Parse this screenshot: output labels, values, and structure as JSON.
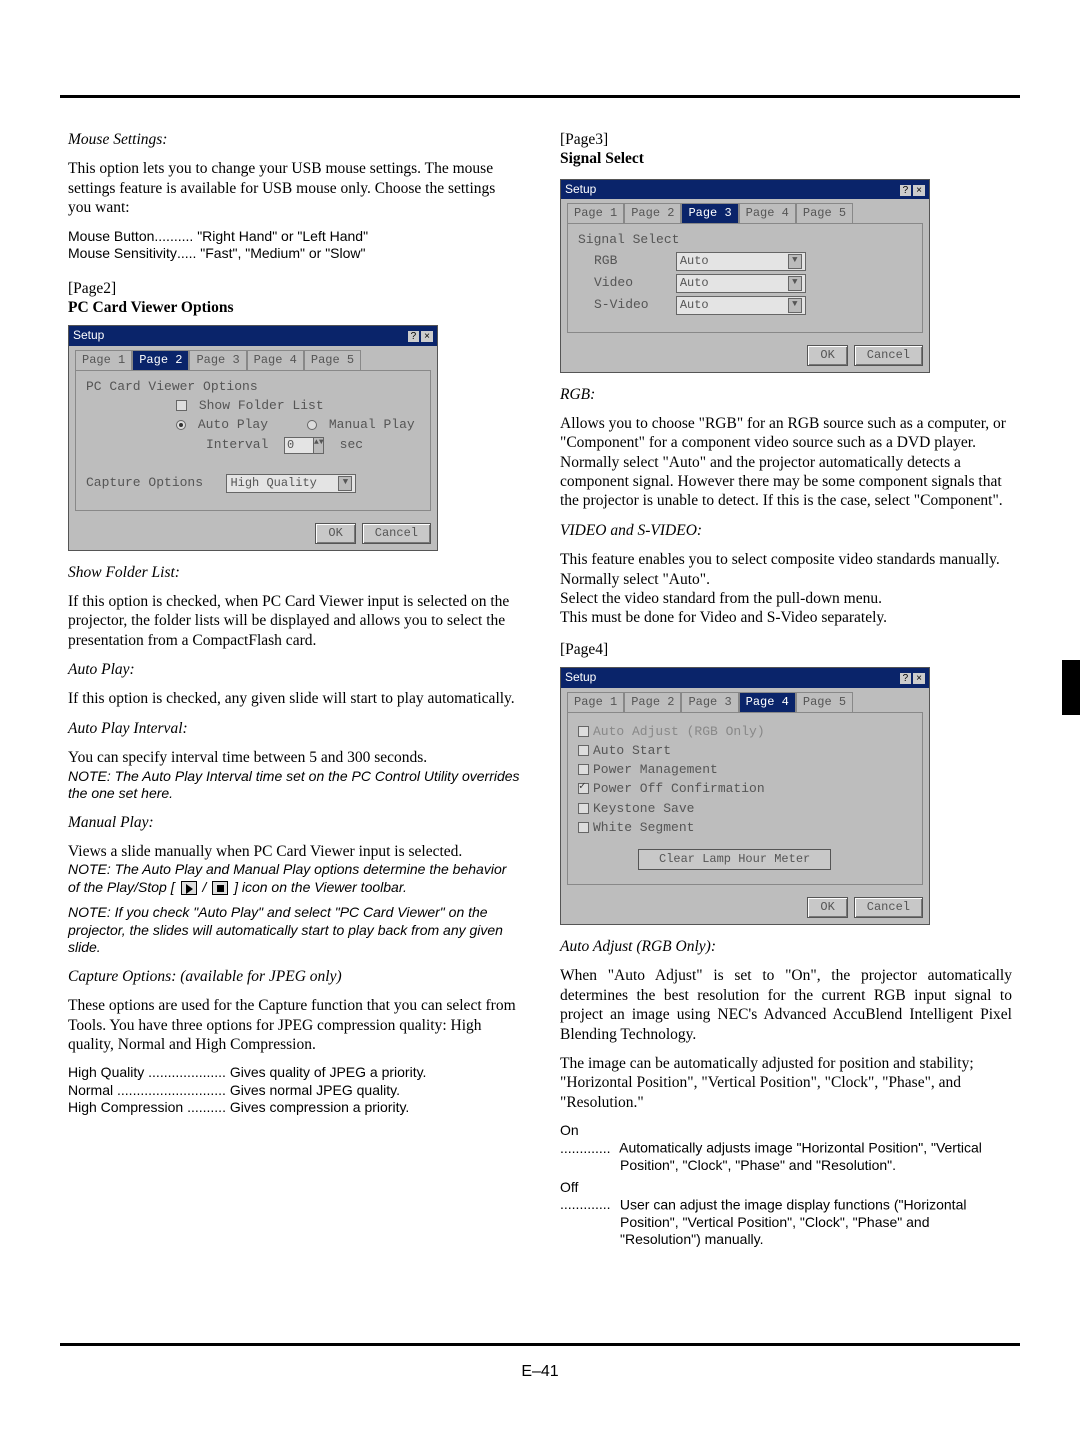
{
  "col1": {
    "mouseSettings": {
      "title": "Mouse Settings:",
      "p1": "This option lets you to change your USB mouse settings. The mouse settings feature is available for USB mouse only. Choose the settings you want:",
      "btn_label": "Mouse Button",
      "btn_dots": "..........",
      "btn_val": "\"Right Hand\" or \"Left Hand\"",
      "sens_label": "Mouse Sensitivity",
      "sens_dots": ".....",
      "sens_val": "\"Fast\", \"Medium\" or \"Slow\""
    },
    "page2_label": "[Page2]",
    "page2_title": "PC Card Viewer Options",
    "dlg2": {
      "title": "Setup",
      "tabs": [
        "Page 1",
        "Page 2",
        "Page 3",
        "Page 4",
        "Page 5"
      ],
      "active_tab": 1,
      "section": "PC Card Viewer Options",
      "chk_show": "Show Folder List",
      "r_auto": "Auto Play",
      "r_manual": "Manual Play",
      "interval_lbl": "Interval",
      "interval_val": "0",
      "interval_unit": "sec",
      "capture_lbl": "Capture Options",
      "capture_val": "High Quality",
      "ok": "OK",
      "cancel": "Cancel"
    },
    "showFolder": {
      "title": "Show Folder List:",
      "p": "If this option is checked, when PC Card Viewer input is selected on the projector, the folder lists will be displayed and allows you to select the presentation from a CompactFlash card."
    },
    "autoPlay": {
      "title": "Auto Play:",
      "p": "If this option is checked, any given slide will start to play automatically."
    },
    "autoPlayInt": {
      "title": "Auto Play Interval:",
      "p": "You can specify interval time between 5 and 300 seconds.",
      "note": "NOTE: The Auto Play Interval time set on the PC Control Utility overrides the one set here."
    },
    "manualPlay": {
      "title": "Manual Play:",
      "p": "Views a slide manually when PC Card Viewer input is selected.",
      "note1a": "NOTE: The Auto Play and Manual Play options determine the behavior of the Play/Stop [",
      "note1b": " / ",
      "note1c": " ] icon on the Viewer toolbar.",
      "note2": "NOTE: If you check \"Auto Play\" and select \"PC Card Viewer\" on the projector, the slides will automatically start to play back from any given slide."
    },
    "capture": {
      "title": "Capture Options: (available for JPEG only)",
      "p": "These options are used for the Capture function that you can select from Tools. You have three options for JPEG compression quality: High quality, Normal and High Compression.",
      "hq_l": "High Quality",
      "hq_d": "....................",
      "hq_v": "Gives quality of JPEG a priority.",
      "nm_l": "Normal",
      "nm_d": "............................",
      "nm_v": "Gives normal JPEG quality.",
      "hc_l": "High Compression",
      "hc_d": "..........",
      "hc_v": "Gives compression a priority."
    }
  },
  "col2": {
    "page3_label": "[Page3]",
    "page3_title": "Signal Select",
    "dlg3": {
      "title": "Setup",
      "tabs": [
        "Page 1",
        "Page 2",
        "Page 3",
        "Page 4",
        "Page 5"
      ],
      "active_tab": 2,
      "section": "Signal Select",
      "rgb_l": "RGB",
      "rgb_v": "Auto",
      "vid_l": "Video",
      "vid_v": "Auto",
      "svid_l": "S-Video",
      "svid_v": "Auto",
      "ok": "OK",
      "cancel": "Cancel"
    },
    "rgb": {
      "title": "RGB:",
      "p": "Allows you to choose \"RGB\" for an RGB source such as a computer, or \"Component\" for a component video source such as a DVD player. Normally select \"Auto\" and the projector automatically detects a component signal. However there may be some component signals that the projector is unable to detect. If this is the case, select \"Component\"."
    },
    "video": {
      "title": "VIDEO and S-VIDEO:",
      "p1": "This feature enables you to select composite video standards manually. Normally select \"Auto\".",
      "p2": "Select the video standard from the pull-down menu.",
      "p3": "This must be done for Video and S-Video separately."
    },
    "page4_label": "[Page4]",
    "dlg4": {
      "title": "Setup",
      "tabs": [
        "Page 1",
        "Page 2",
        "Page 3",
        "Page 4",
        "Page 5"
      ],
      "active_tab": 3,
      "items": [
        {
          "label": "Auto Adjust (RGB Only)",
          "checked": false,
          "grey": true
        },
        {
          "label": "Auto Start",
          "checked": false
        },
        {
          "label": "Power Management",
          "checked": false
        },
        {
          "label": "Power Off Confirmation",
          "checked": true
        },
        {
          "label": "Keystone Save",
          "checked": false
        },
        {
          "label": "White Segment",
          "checked": false
        }
      ],
      "clear_btn": "Clear Lamp Hour Meter",
      "ok": "OK",
      "cancel": "Cancel"
    },
    "autoAdj": {
      "title": "Auto Adjust (RGB Only):",
      "p1": "When \"Auto Adjust\" is set to \"On\", the projector automatically determines the best resolution for the current RGB input signal to project an image using NEC's Advanced AccuBlend Intelligent Pixel Blending Technology.",
      "p2": "The image can be automatically adjusted for position and stability; \"Horizontal Position\", \"Vertical Position\", \"Clock\", \"Phase\", and \"Resolution.\"",
      "on_l": "On",
      "on_d": ".............",
      "on_v": "Automatically adjusts image \"Horizontal Position\", \"Vertical Position\", \"Clock\", \"Phase\" and \"Resolution\".",
      "off_l": "Off",
      "off_d": ".............",
      "off_v": "User can adjust the image display functions (\"Horizontal Position\", \"Vertical Position\", \"Clock\", \"Phase\" and \"Resolution\") manually."
    }
  },
  "page_num": "E–41"
}
